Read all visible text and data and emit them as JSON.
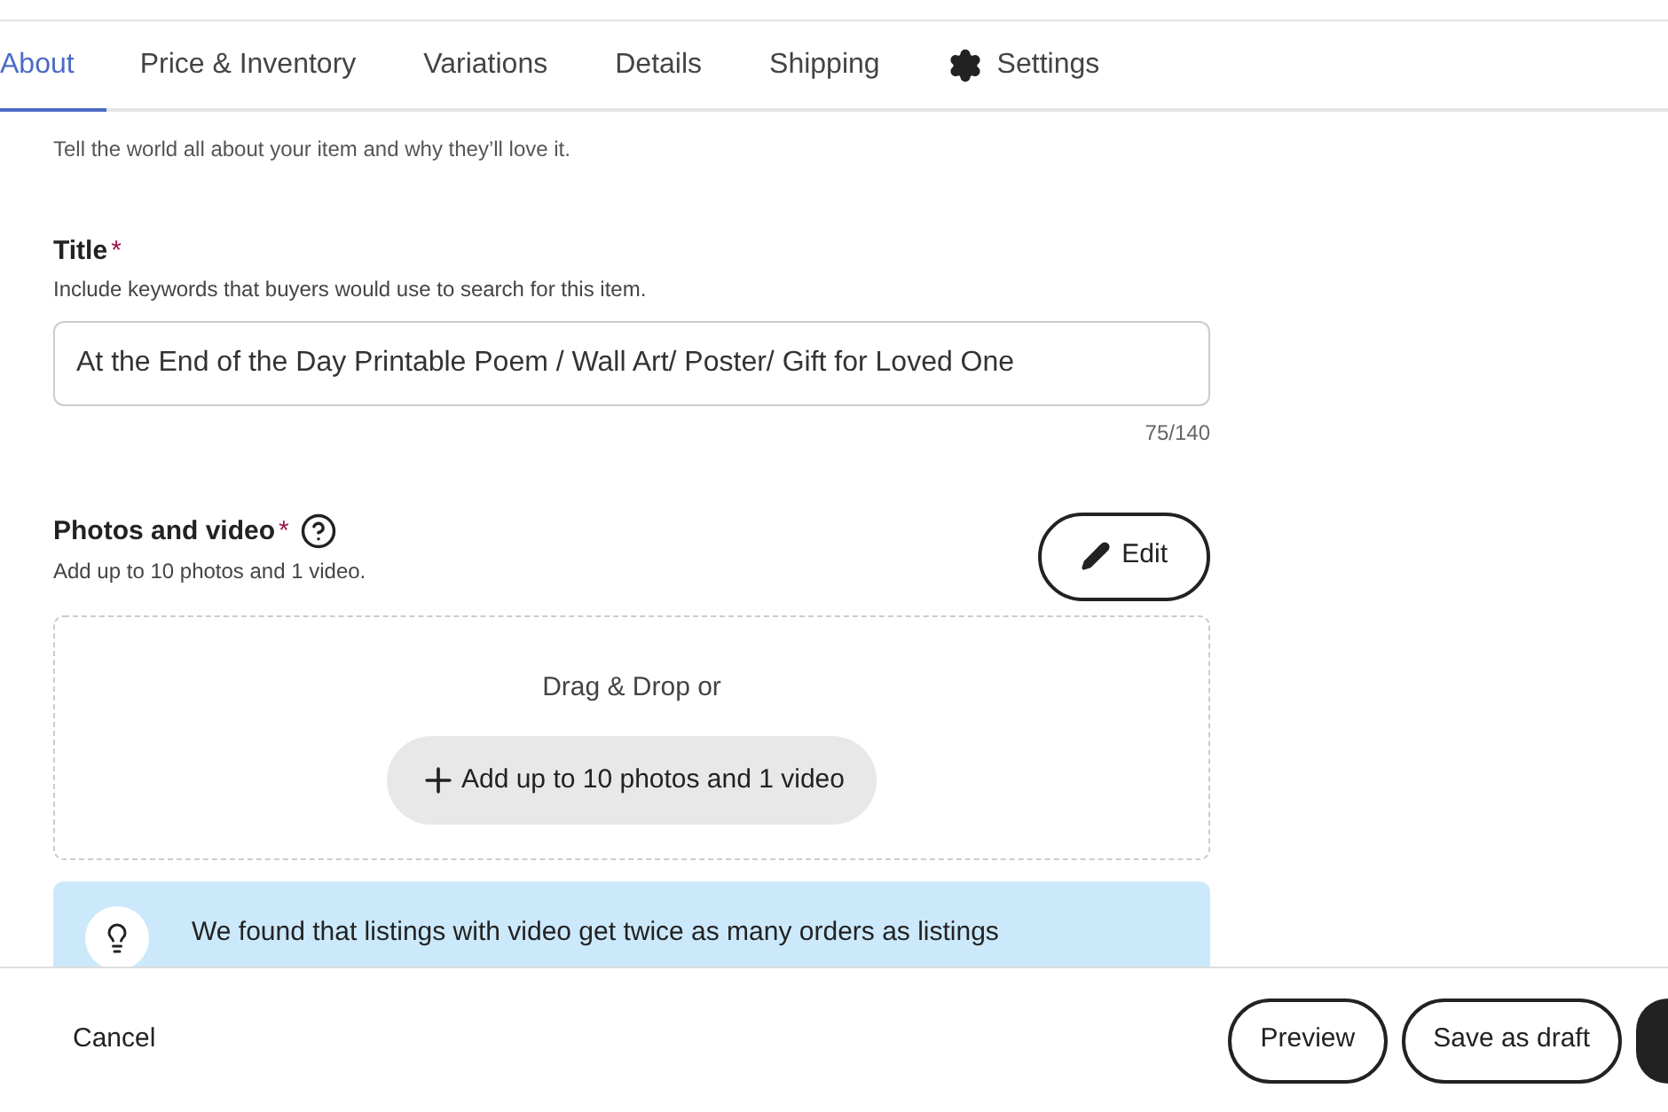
{
  "tabs": [
    {
      "label": "About",
      "selected": true,
      "kind": "text"
    },
    {
      "label": "Price & Inventory",
      "selected": false,
      "kind": "text"
    },
    {
      "label": "Variations",
      "selected": false,
      "kind": "text"
    },
    {
      "label": "Details",
      "selected": false,
      "kind": "text"
    },
    {
      "label": "Shipping",
      "selected": false,
      "kind": "text"
    },
    {
      "label": "Settings",
      "selected": false,
      "kind": "gear"
    }
  ],
  "about": {
    "description": "Tell the world all about your item and why they’ll love it."
  },
  "title_field": {
    "label": "Title",
    "required_mark": "*",
    "hint": "Include keywords that buyers would use to search for this item.",
    "value": "At the End of the Day Printable Poem / Wall Art/ Poster/ Gift for Loved One",
    "counter": "75/140"
  },
  "photos": {
    "label": "Photos and video",
    "required_mark": "*",
    "hint": "Add up to 10 photos and 1 video.",
    "edit_button": "Edit",
    "drop_text": "Drag & Drop or",
    "add_button": "Add up to 10 photos and 1 video"
  },
  "tip": {
    "text": "We found that listings with video get twice as many orders as listings"
  },
  "footer": {
    "cancel": "Cancel",
    "buttons": [
      "Preview",
      "Save as draft"
    ]
  }
}
